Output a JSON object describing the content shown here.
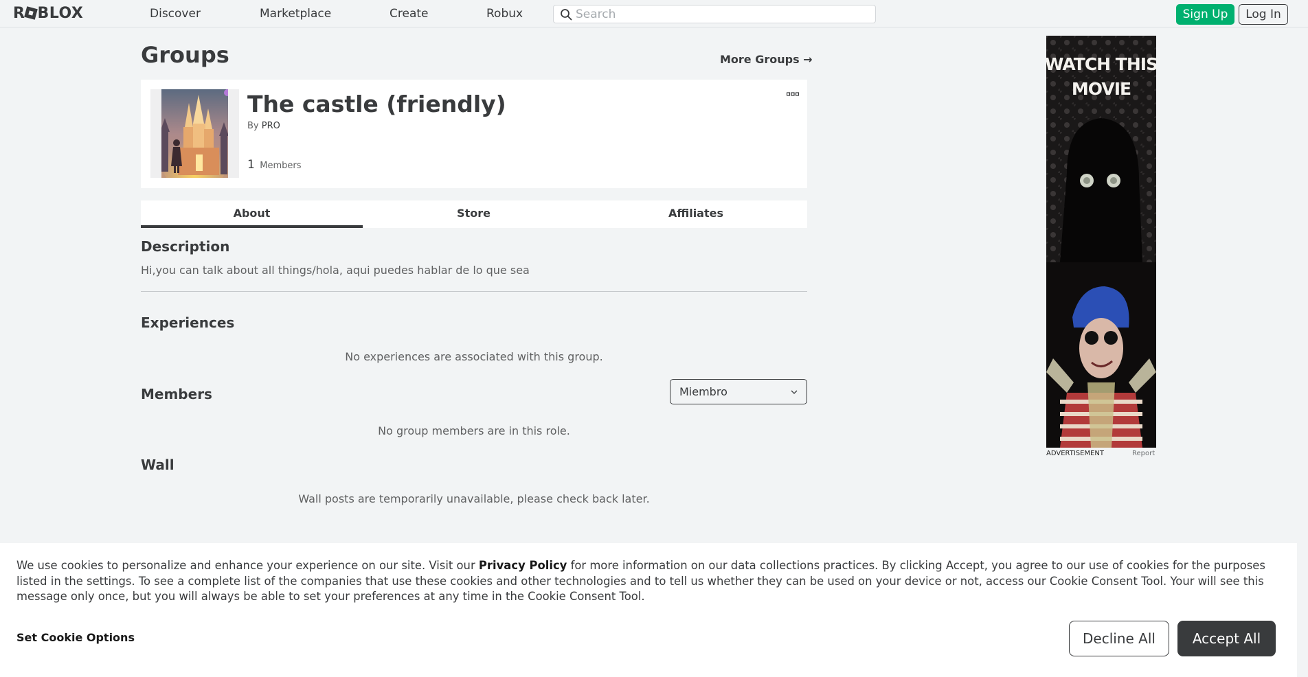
{
  "nav": {
    "logo": "ROBLOX",
    "links": [
      "Discover",
      "Marketplace",
      "Create",
      "Robux"
    ],
    "search": {
      "placeholder": "Search",
      "value": ""
    },
    "signup_label": "Sign Up",
    "login_label": "Log In"
  },
  "page": {
    "title": "Groups",
    "more_groups": "More Groups →"
  },
  "group": {
    "name": "The castle (friendly)",
    "by_prefix": "By",
    "owner": "PRO",
    "member_count": "1",
    "members_label": "Members"
  },
  "tabs": [
    "About",
    "Store",
    "Affiliates"
  ],
  "about": {
    "description_heading": "Description",
    "description": "Hi,you can talk about all things/hola, aqui puedes hablar de lo que sea",
    "experiences_heading": "Experiences",
    "experiences_empty": "No experiences are associated with this group.",
    "members_heading": "Members",
    "role_selected": "Miembro",
    "members_empty": "No group members are in this role.",
    "wall_heading": "Wall",
    "wall_empty": "Wall posts are temporarily unavailable, please check back later."
  },
  "ad": {
    "headline": "WATCH THIS MOVIE",
    "caption": "ADVERTISEMENT",
    "report": "Report"
  },
  "cookie": {
    "text_before": "We use cookies to personalize and enhance your experience on our site. Visit our ",
    "privacy_link": "Privacy Policy",
    "text_after": " for more information on our data collections practices. By clicking Accept, you agree to our use of cookies for the purposes listed in the settings. To see a complete list of the companies that use these cookies and other technologies and to tell us whether they can be used on your device or not, access our Cookie Consent Tool. Your will see this message only once, but you will always be able to set your preferences at any time in the Cookie Consent Tool.",
    "settings_label": "Set Cookie Options",
    "decline_label": "Decline All",
    "accept_label": "Accept All"
  },
  "colors": {
    "signup_green": "#00b06f",
    "text_primary": "#393b3d",
    "page_bg": "#f2f4f5"
  }
}
